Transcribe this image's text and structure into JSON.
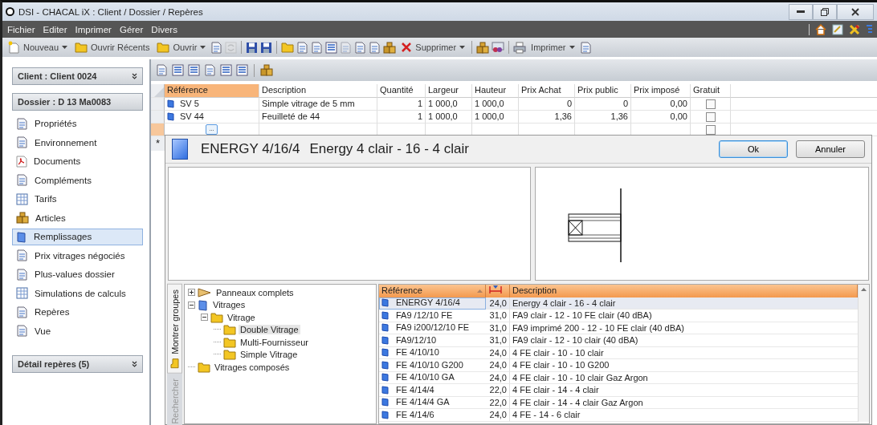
{
  "window": {
    "title": "DSI - CHACAL iX : Client / Dossier / Repères"
  },
  "menu": [
    "Fichier",
    "Editer",
    "Imprimer",
    "Gérer",
    "Divers"
  ],
  "toolbar": [
    {
      "kind": "button",
      "label": "Nouveau",
      "icon": true,
      "dropdown": true
    },
    {
      "kind": "button",
      "label": "Ouvrir Récents",
      "icon": true,
      "dropdown": false
    },
    {
      "kind": "button",
      "label": "Ouvrir",
      "icon": true,
      "dropdown": true
    },
    {
      "kind": "icon",
      "disabled": false
    },
    {
      "kind": "icon",
      "disabled": true
    },
    {
      "kind": "separator"
    },
    {
      "kind": "icon",
      "disabled": false
    },
    {
      "kind": "icon",
      "disabled": false
    },
    {
      "kind": "separator"
    },
    {
      "kind": "icon",
      "disabled": false
    },
    {
      "kind": "icon",
      "disabled": false
    },
    {
      "kind": "icon",
      "disabled": false
    },
    {
      "kind": "icon",
      "disabled": false
    },
    {
      "kind": "icon",
      "disabled": true
    },
    {
      "kind": "icon",
      "disabled": false
    },
    {
      "kind": "icon",
      "disabled": false
    },
    {
      "kind": "icon",
      "disabled": false
    },
    {
      "kind": "button",
      "label": "Supprimer",
      "icon": true,
      "dropdown": true
    },
    {
      "kind": "separator"
    },
    {
      "kind": "icon",
      "disabled": false
    },
    {
      "kind": "icon",
      "disabled": false
    },
    {
      "kind": "separator"
    },
    {
      "kind": "icon",
      "disabled": false
    },
    {
      "kind": "button",
      "label": "Imprimer",
      "icon": false,
      "dropdown": true
    },
    {
      "kind": "icon",
      "disabled": false
    }
  ],
  "sidebar": {
    "panels": [
      {
        "title": "Client : Client 0024",
        "collapsible": true
      },
      {
        "title": "Dossier : D 13 Ma0083",
        "collapsible": false,
        "items": [
          {
            "label": "Propriétés",
            "selected": false
          },
          {
            "label": "Environnement",
            "selected": false
          },
          {
            "label": "Documents",
            "selected": false
          },
          {
            "label": "Compléments",
            "selected": false
          },
          {
            "label": "Tarifs",
            "selected": false
          },
          {
            "label": "Articles",
            "selected": false
          },
          {
            "label": "Remplissages",
            "selected": true
          },
          {
            "label": "Prix vitrages négociés",
            "selected": false
          },
          {
            "label": "Plus-values dossier",
            "selected": false
          },
          {
            "label": "Simulations de calculs",
            "selected": false
          },
          {
            "label": "Repères",
            "selected": false
          },
          {
            "label": "Vue",
            "selected": false
          }
        ]
      },
      {
        "title": "Détail repères (5)",
        "collapsible": true
      }
    ]
  },
  "grid": {
    "columns": [
      {
        "label": "Référence",
        "selected": true
      },
      {
        "label": "Description",
        "selected": false
      },
      {
        "label": "Quantité",
        "selected": false
      },
      {
        "label": "Largeur",
        "selected": false
      },
      {
        "label": "Hauteur",
        "selected": false
      },
      {
        "label": "Prix Achat",
        "selected": false
      },
      {
        "label": "Prix public",
        "selected": false
      },
      {
        "label": "Prix imposé",
        "selected": false
      },
      {
        "label": "Gratuit",
        "selected": false
      }
    ],
    "rows": [
      {
        "kind": "data",
        "current": false,
        "cells": [
          "SV 5",
          "Simple vitrage de 5 mm",
          "1",
          "1 000,0",
          "1 000,0",
          "0",
          "0",
          "0,00"
        ],
        "gratuit": false
      },
      {
        "kind": "data",
        "current": false,
        "cells": [
          "SV 44",
          "Feuilleté de 44",
          "1",
          "1 000,0",
          "1 000,0",
          "1,36",
          "1,36",
          "0,00"
        ],
        "gratuit": false
      },
      {
        "kind": "edit",
        "current": true,
        "button": "...",
        "gratuit": false
      }
    ],
    "new_row_marker": "*"
  },
  "dialog": {
    "reference": "ENERGY 4/16/4",
    "description": "Energy 4 clair - 16 - 4 clair",
    "buttons": [
      {
        "label": "Ok",
        "default": true
      },
      {
        "label": "Annuler",
        "default": false
      }
    ],
    "side_tabs": [
      {
        "label": "Montrer groupes",
        "selected": true
      },
      {
        "label": "Rechercher",
        "selected": false
      }
    ],
    "tree": [
      {
        "label": "Panneaux complets",
        "kind": "panel",
        "expanded": false,
        "selected": false
      },
      {
        "label": "Vitrages",
        "kind": "glass",
        "expanded": true,
        "selected": false,
        "children": [
          {
            "label": "Vitrage",
            "kind": "folder",
            "expanded": true,
            "selected": false,
            "children": [
              {
                "label": "Double Vitrage",
                "kind": "folder",
                "selected": true
              },
              {
                "label": "Multi-Fournisseur",
                "kind": "folder",
                "selected": false
              },
              {
                "label": "Simple Vitrage",
                "kind": "folder",
                "selected": false
              }
            ]
          }
        ]
      },
      {
        "label": "Vitrages composés",
        "kind": "folder",
        "selected": false
      }
    ],
    "list": {
      "columns": {
        "reference": "Référence",
        "description": "Description"
      },
      "rows": [
        {
          "reference": "ENERGY 4/16/4",
          "thickness": "24,0",
          "description": "Energy 4 clair - 16 - 4 clair",
          "selected": true
        },
        {
          "reference": "FA9 /12/10 FE",
          "thickness": "31,0",
          "description": "FA9 clair - 12 - 10 FE clair (40 dBA)",
          "selected": false
        },
        {
          "reference": "FA9 i200/12/10 FE",
          "thickness": "31,0",
          "description": "FA9 imprimé 200 - 12 - 10 FE clair (40 dBA)",
          "selected": false
        },
        {
          "reference": "FA9/12/10",
          "thickness": "31,0",
          "description": "FA9 clair - 12 - 10 clair (40 dBA)",
          "selected": false
        },
        {
          "reference": "FE 4/10/10",
          "thickness": "24,0",
          "description": "4 FE clair - 10 - 10 clair",
          "selected": false
        },
        {
          "reference": "FE 4/10/10 G200",
          "thickness": "24,0",
          "description": "4 FE clair - 10 - 10 G200",
          "selected": false
        },
        {
          "reference": "FE 4/10/10 GA",
          "thickness": "24,0",
          "description": "4 FE clair - 10 - 10 clair Gaz Argon",
          "selected": false
        },
        {
          "reference": "FE 4/14/4",
          "thickness": "22,0",
          "description": "4 FE clair - 14 - 4 clair",
          "selected": false
        },
        {
          "reference": "FE 4/14/4 GA",
          "thickness": "22,0",
          "description": "4 FE clair - 14 - 4 clair Gaz Argon",
          "selected": false
        },
        {
          "reference": "FE 4/14/6",
          "thickness": "24,0",
          "description": "4 FE - 14 - 6 clair",
          "selected": false
        }
      ]
    }
  }
}
